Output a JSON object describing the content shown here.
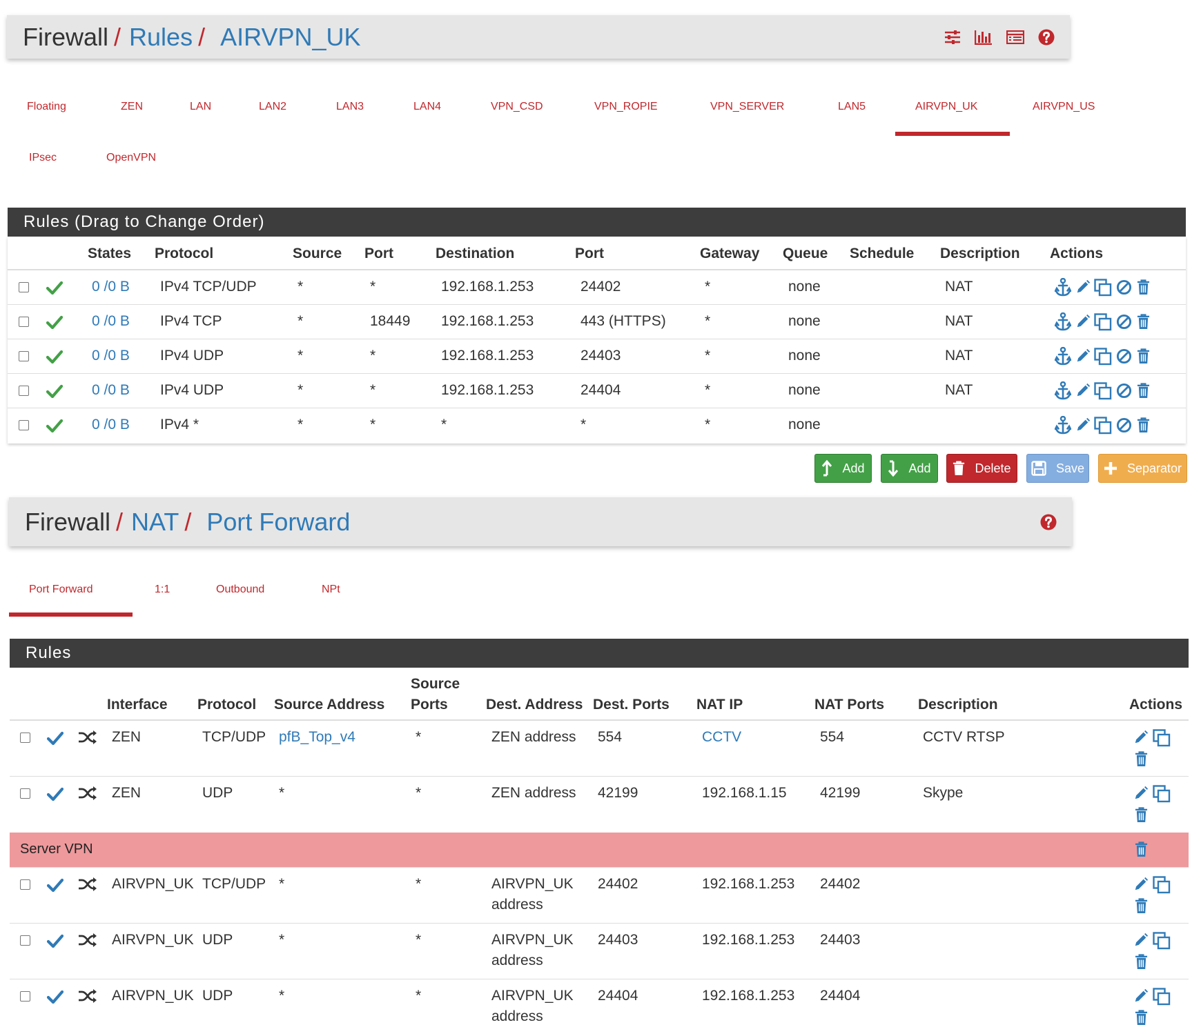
{
  "rules_page": {
    "breadcrumb": {
      "root": "Firewall",
      "sep": "/",
      "level1": "Rules",
      "level2": "AIRVPN_UK"
    },
    "icons": [
      "sliders-icon",
      "bar-chart-icon",
      "list-icon",
      "help-icon"
    ],
    "tabs": [
      "Floating",
      "ZEN",
      "LAN",
      "LAN2",
      "LAN3",
      "LAN4",
      "VPN_CSD",
      "VPN_ROPIE",
      "VPN_SERVER",
      "LAN5",
      "AIRVPN_UK",
      "AIRVPN_US",
      "IPsec",
      "OpenVPN"
    ],
    "active_tab": "AIRVPN_UK",
    "panel_title": "Rules (Drag to Change Order)",
    "columns": [
      "States",
      "Protocol",
      "Source",
      "Port",
      "Destination",
      "Port",
      "Gateway",
      "Queue",
      "Schedule",
      "Description",
      "Actions"
    ],
    "rows": [
      {
        "states": "0 /0 B",
        "protocol": "IPv4 TCP/UDP",
        "source": "*",
        "port": "*",
        "destination": "192.168.1.253",
        "dport": "24402",
        "gateway": "*",
        "queue": "none",
        "schedule": "",
        "description": "NAT"
      },
      {
        "states": "0 /0 B",
        "protocol": "IPv4 TCP",
        "source": "*",
        "port": "18449",
        "destination": "192.168.1.253",
        "dport": "443 (HTTPS)",
        "gateway": "*",
        "queue": "none",
        "schedule": "",
        "description": "NAT"
      },
      {
        "states": "0 /0 B",
        "protocol": "IPv4 UDP",
        "source": "*",
        "port": "*",
        "destination": "192.168.1.253",
        "dport": "24403",
        "gateway": "*",
        "queue": "none",
        "schedule": "",
        "description": "NAT"
      },
      {
        "states": "0 /0 B",
        "protocol": "IPv4 UDP",
        "source": "*",
        "port": "*",
        "destination": "192.168.1.253",
        "dport": "24404",
        "gateway": "*",
        "queue": "none",
        "schedule": "",
        "description": "NAT"
      },
      {
        "states": "0 /0 B",
        "protocol": "IPv4 *",
        "source": "*",
        "port": "*",
        "destination": "*",
        "dport": "*",
        "gateway": "*",
        "queue": "none",
        "schedule": "",
        "description": ""
      }
    ],
    "buttons": {
      "add_top": "Add",
      "add_bottom": "Add",
      "delete": "Delete",
      "save": "Save",
      "separator": "Separator"
    }
  },
  "nat_page": {
    "breadcrumb": {
      "root": "Firewall",
      "sep": "/",
      "level1": "NAT",
      "level2": "Port Forward"
    },
    "tabs": [
      "Port Forward",
      "1:1",
      "Outbound",
      "NPt"
    ],
    "active_tab": "Port Forward",
    "panel_title": "Rules",
    "columns": {
      "interface": "Interface",
      "protocol": "Protocol",
      "source_address": "Source Address",
      "source_ports_1": "Source",
      "source_ports_2": "Ports",
      "dest_address": "Dest. Address",
      "dest_ports": "Dest. Ports",
      "nat_ip": "NAT IP",
      "nat_ports": "NAT Ports",
      "description": "Description",
      "actions": "Actions"
    },
    "rows": [
      {
        "interface": "ZEN",
        "protocol": "TCP/UDP",
        "source_address": "pfB_Top_v4",
        "source_ports": "*",
        "dest_address_1": "ZEN address",
        "dest_address_2": "",
        "dest_ports": "554",
        "nat_ip": "CCTV",
        "nat_ports": "554",
        "description": "CCTV RTSP"
      },
      {
        "interface": "ZEN",
        "protocol": "UDP",
        "source_address": "*",
        "source_ports": "*",
        "dest_address_1": "ZEN address",
        "dest_address_2": "",
        "dest_ports": "42199",
        "nat_ip": "192.168.1.15",
        "nat_ports": "42199",
        "description": "Skype"
      },
      {
        "interface": "AIRVPN_UK",
        "protocol": "TCP/UDP",
        "source_address": "*",
        "source_ports": "*",
        "dest_address_1": "AIRVPN_UK",
        "dest_address_2": "address",
        "dest_ports": "24402",
        "nat_ip": "192.168.1.253",
        "nat_ports": "24402",
        "description": ""
      },
      {
        "interface": "AIRVPN_UK",
        "protocol": "UDP",
        "source_address": "*",
        "source_ports": "*",
        "dest_address_1": "AIRVPN_UK",
        "dest_address_2": "address",
        "dest_ports": "24403",
        "nat_ip": "192.168.1.253",
        "nat_ports": "24403",
        "description": ""
      },
      {
        "interface": "AIRVPN_UK",
        "protocol": "UDP",
        "source_address": "*",
        "source_ports": "*",
        "dest_address_1": "AIRVPN_UK",
        "dest_address_2": "address",
        "dest_ports": "24404",
        "nat_ip": "192.168.1.253",
        "nat_ports": "24404",
        "description": ""
      }
    ],
    "separator_label": "Server VPN"
  },
  "colors": {
    "brand_red": "#c0282d",
    "link_blue": "#2f7ab7",
    "pass_green": "#43a047",
    "separator_pink": "#ee999c",
    "panel_dark": "#3d3d3d"
  }
}
